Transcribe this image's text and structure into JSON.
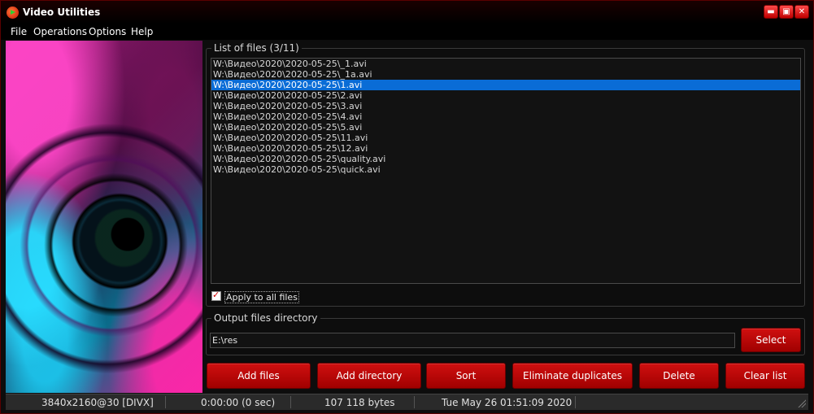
{
  "window": {
    "title": "Video Utilities",
    "controls": {
      "minimize": "▬",
      "maximize": "▣",
      "close": "✕"
    }
  },
  "menu": [
    "File",
    "Operations",
    "Options",
    "Help"
  ],
  "files_group": {
    "label": "List of files (3/11)",
    "selected_index": 2,
    "items": [
      "W:\\Видео\\2020\\2020-05-25\\_1.avi",
      "W:\\Видео\\2020\\2020-05-25\\_1a.avi",
      "W:\\Видео\\2020\\2020-05-25\\1.avi",
      "W:\\Видео\\2020\\2020-05-25\\2.avi",
      "W:\\Видео\\2020\\2020-05-25\\3.avi",
      "W:\\Видео\\2020\\2020-05-25\\4.avi",
      "W:\\Видео\\2020\\2020-05-25\\5.avi",
      "W:\\Видео\\2020\\2020-05-25\\11.avi",
      "W:\\Видео\\2020\\2020-05-25\\12.avi",
      "W:\\Видео\\2020\\2020-05-25\\quality.avi",
      "W:\\Видео\\2020\\2020-05-25\\quick.avi"
    ],
    "apply_all": {
      "label": "Apply to all files",
      "checked": true
    }
  },
  "output_group": {
    "label": "Output files directory",
    "value": "E:\\res",
    "select_label": "Select"
  },
  "actions": [
    "Add files",
    "Add directory",
    "Sort",
    "Eliminate duplicates",
    "Delete",
    "Clear list"
  ],
  "status": {
    "resolution": "3840x2160@30 [DIVX]",
    "duration": "0:00:00 (0 sec)",
    "size": "107 118 bytes",
    "datetime": "Tue May 26 01:51:09 2020"
  },
  "colors": {
    "accent": "#c00000",
    "selection": "#0a6cd6"
  }
}
